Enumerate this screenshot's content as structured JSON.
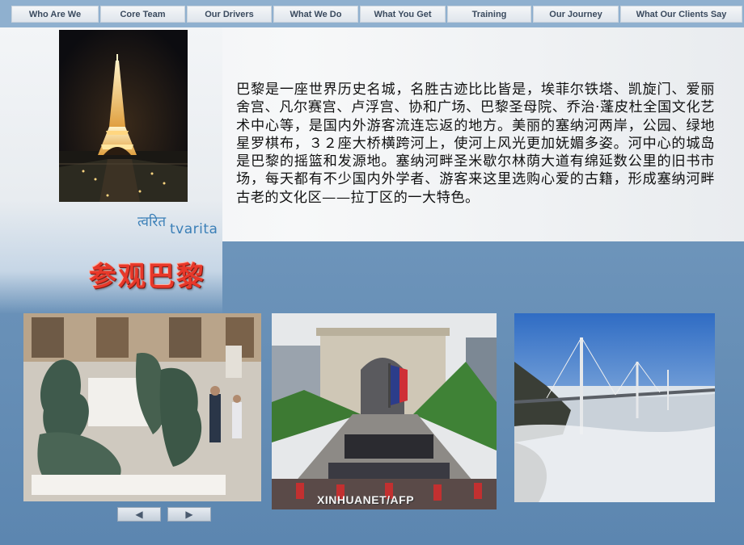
{
  "nav": {
    "tabs": [
      {
        "label": "Who Are We"
      },
      {
        "label": "Core Team"
      },
      {
        "label": "Our Drivers"
      },
      {
        "label": "What We Do"
      },
      {
        "label": "What You Get"
      },
      {
        "label": "Training"
      },
      {
        "label": "Our Journey"
      },
      {
        "label": "What Our Clients Say"
      }
    ]
  },
  "main": {
    "paragraph": "巴黎是一座世界历史名城，名胜古迹比比皆是，埃菲尔铁塔、凯旋门、爱丽舍宫、凡尔赛宫、卢浮宫、协和广场、巴黎圣母院、乔治·蓬皮杜全国文化艺术中心等，是国内外游客流连忘返的地方。美丽的塞纳河两岸，公园、绿地星罗棋布，３２座大桥横跨河上，使河上风光更加妩媚多姿。河中心的城岛是巴黎的摇篮和发源地。塞纳河畔圣米歇尔林荫大道有绵延数公里的旧书市场，每天都有不少国内外学者、游客来这里选购心爱的古籍，形成塞纳河畔古老的文化区——拉丁区的一大特色。",
    "heading": "参观巴黎"
  },
  "logo": {
    "devanagari": "त्वरित",
    "latin": "tvarita"
  },
  "gallery": {
    "photo2_watermark": "XINHUANET/AFP",
    "prev_icon": "left-triangle-icon",
    "next_icon": "right-triangle-icon",
    "prev_glyph": "◀",
    "next_glyph": "▶"
  },
  "colors": {
    "heading": "#e8382a",
    "nav_bg": "#8fb0cf",
    "logo": "#3b7fb7"
  }
}
